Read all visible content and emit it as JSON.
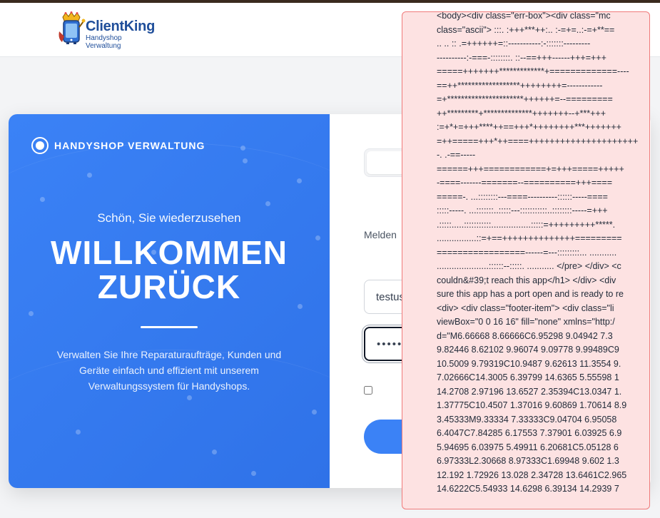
{
  "brand": {
    "name": "ClientKing",
    "tagline": "Handyshop Verwaltung"
  },
  "welcome": {
    "badge": "HANDYSHOP VERWALTUNG",
    "greeting": "Schön, Sie wiederzusehen",
    "headline_line1": "WILLKOMMEN",
    "headline_line2": "ZURÜCK",
    "description": "Verwalten Sie Ihre Reparaturaufträge, Kunden und Geräte einfach und effizient mit unserem Verwaltungssystem für Handyshops."
  },
  "login": {
    "hint": "Melden",
    "username_value": "testus",
    "password_value": "•••••",
    "remember_checked": false
  },
  "error_overlay": {
    "text": "<body><div class=\"err-box\"><div class=\"mc\nclass=\"ascii\"> :::. :+++***++:.. :-=+=..:-=+**==\n.. .. :: .=++++++=::-----------:-:::::::---------\n----------:-===-::::::::. ::--==+++------+++=+++\n=====+++++++*************+=============----\n==++******************++++++++=------------\n=+**********************++++++=--=========\n++*********+**************+++++++--+***+++\n:=+*+=+++****++==+++*++++++++***+++++++\n=++=====+++*++====+++++++++++++++++++++\n-. .-==-----\n======+++============+=+++=====+++++\n-====-------=======--==========+++====\n=====-. ...::::::::---====----------::::::-----====\n:::::-----. ...:::::::..:::::---:::::::::::..::::::::-----=+++\n.:::::.....:::::::::::................:::::=+++++++++*****.\n................::=+==++++++++++++++=========\n=================------=---:::::::::... ...........\n.....................::::::--:::::. ........... </pre> </div> <c\ncouldn&#39;t reach this app</h1> </div> <div\nsure this app has a port open and is ready to re\n<div> <div class=\"footer-item\"> <div class=\"li\nviewBox=\"0 0 16 16\" fill=\"none\" xmlns=\"http:/\nd=\"M6.66668 8.66666C6.95298 9.04942 7.3\n9.82446 8.62102 9.96074 9.09778 9.99489C9\n10.5009 9.79319C10.9487 9.62613 11.3554 9.\n7.02666C14.3005 6.39799 14.6365 5.55598 1\n14.2708 2.97196 13.6527 2.35394C13.0347 1.\n1.37775C10.4507 1.37016 9.60869 1.70614 8.9\n3.45333M9.33334 7.33333C9.04704 6.95058\n6.4047C7.84285 6.17553 7.37901 6.03925 6.9\n5.94695 6.03975 5.49911 6.20681C5.05128 6\n6.97333L2.30668 8.97333C1.69948 9.602 1.3\n12.192 1.72926 13.028 2.34728 13.6461C2.965\n14.6222C5.54933 14.6298 6.39134 14.2939 7\n "
  }
}
